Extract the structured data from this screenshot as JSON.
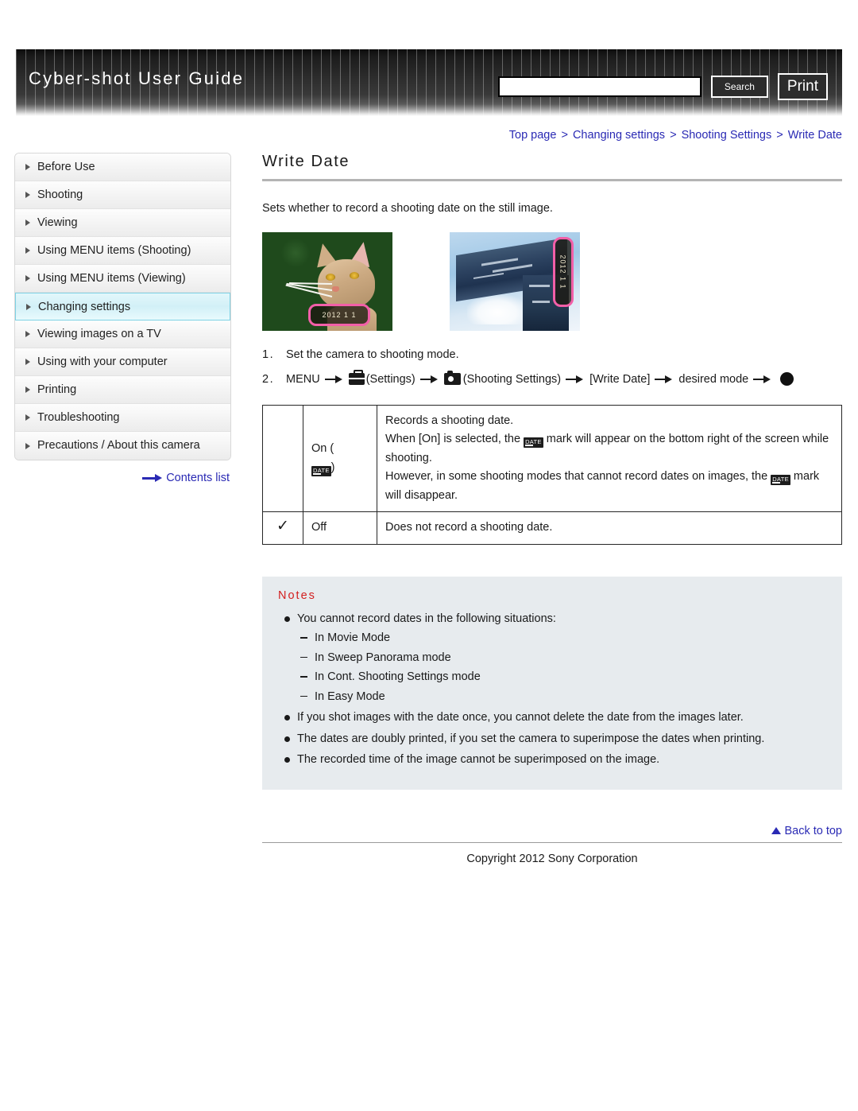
{
  "header": {
    "title": "Cyber-shot User Guide",
    "search_value": "",
    "search_placeholder": "",
    "search_button": "Search",
    "print_button": "Print"
  },
  "breadcrumb": {
    "items": [
      "Top page",
      "Changing settings",
      "Shooting Settings",
      "Write Date"
    ],
    "separator": ">"
  },
  "sidebar": {
    "items": [
      {
        "label": "Before Use",
        "active": false
      },
      {
        "label": "Shooting",
        "active": false
      },
      {
        "label": "Viewing",
        "active": false
      },
      {
        "label": "Using MENU items (Shooting)",
        "active": false
      },
      {
        "label": "Using MENU items (Viewing)",
        "active": false
      },
      {
        "label": "Changing settings",
        "active": true
      },
      {
        "label": "Viewing images on a TV",
        "active": false
      },
      {
        "label": "Using with your computer",
        "active": false
      },
      {
        "label": "Printing",
        "active": false
      },
      {
        "label": "Troubleshooting",
        "active": false
      },
      {
        "label": "Precautions / About this camera",
        "active": false
      }
    ],
    "contents_link": "Contents list"
  },
  "main": {
    "title": "Write Date",
    "lead": "Sets whether to record a shooting date on the still image.",
    "samples": [
      {
        "caption": "",
        "date_stamp": "2012 1 1",
        "subject": "cat"
      },
      {
        "caption": "",
        "date_stamp": "2012 1 1",
        "subject": "building"
      }
    ],
    "steps": [
      {
        "num": "1.",
        "text": "Set the camera to shooting mode."
      },
      {
        "num": "2.",
        "parts": {
          "menu": "MENU",
          "settings": "(Settings)",
          "shooting_settings": "(Shooting Settings)",
          "write_date": "[Write Date]",
          "desired_mode": "desired mode"
        }
      }
    ],
    "table": {
      "rows": [
        {
          "checked": false,
          "label": "On (",
          "label_suffix": ")",
          "badge": "DATE",
          "lines": [
            "Records a shooting date.",
            "When [On] is selected, the",
            "mark will appear on the bottom right of the screen while shooting.",
            "However, in some shooting modes that cannot record dates on images, the",
            "mark will disappear."
          ]
        },
        {
          "checked": true,
          "label": "Off",
          "description": "Does not record a shooting date."
        }
      ],
      "check_glyph": "✓"
    },
    "notes": {
      "title": "Notes",
      "items": [
        {
          "text": "You cannot record dates in the following situations:",
          "sub": [
            "In Movie Mode",
            "In Sweep Panorama mode",
            "In Cont. Shooting Settings mode",
            "In Easy Mode"
          ]
        },
        {
          "text": "If you shot images with the date once, you cannot delete the date from the images later.",
          "sub": []
        },
        {
          "text": "The dates are doubly printed, if you set the camera to superimpose the dates when printing.",
          "sub": []
        },
        {
          "text": "The recorded time of the image cannot be superimposed on the image.",
          "sub": []
        }
      ]
    }
  },
  "footer": {
    "back_to_top": "Back to top",
    "copyright": "Copyright 2012 Sony Corporation"
  },
  "colors": {
    "link": "#2a2ab4",
    "notes_title": "#d32020",
    "notes_bg": "#e7ebee",
    "active_nav": "#d2f0f7",
    "stamp_outline": "#f25fa8"
  }
}
